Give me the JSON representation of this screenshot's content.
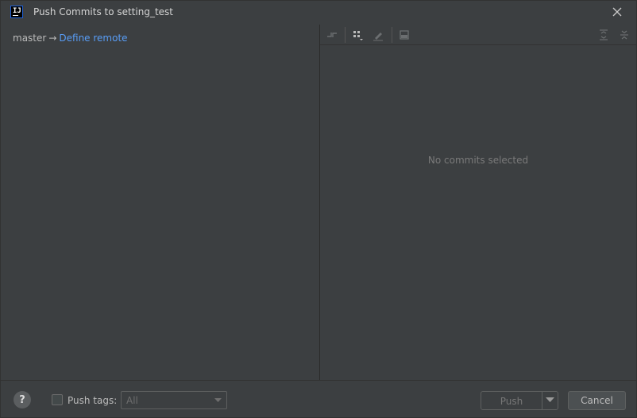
{
  "window": {
    "title": "Push Commits to setting_test",
    "logo_text": "IJ"
  },
  "left": {
    "branch": "master",
    "arrow": "→",
    "define_remote": "Define remote"
  },
  "right": {
    "empty_message": "No commits selected",
    "toolbar": [
      "collapse-icon",
      "group-by-icon",
      "edit-icon",
      "preview-icon",
      "expand-all-icon",
      "collapse-all-icon"
    ]
  },
  "bottom": {
    "help": "?",
    "push_tags_label": "Push tags:",
    "tags_value": "All",
    "push_label": "Push",
    "cancel_label": "Cancel"
  },
  "colors": {
    "background": "#3c3f41",
    "link": "#589df6",
    "text": "#bbbbbb"
  }
}
